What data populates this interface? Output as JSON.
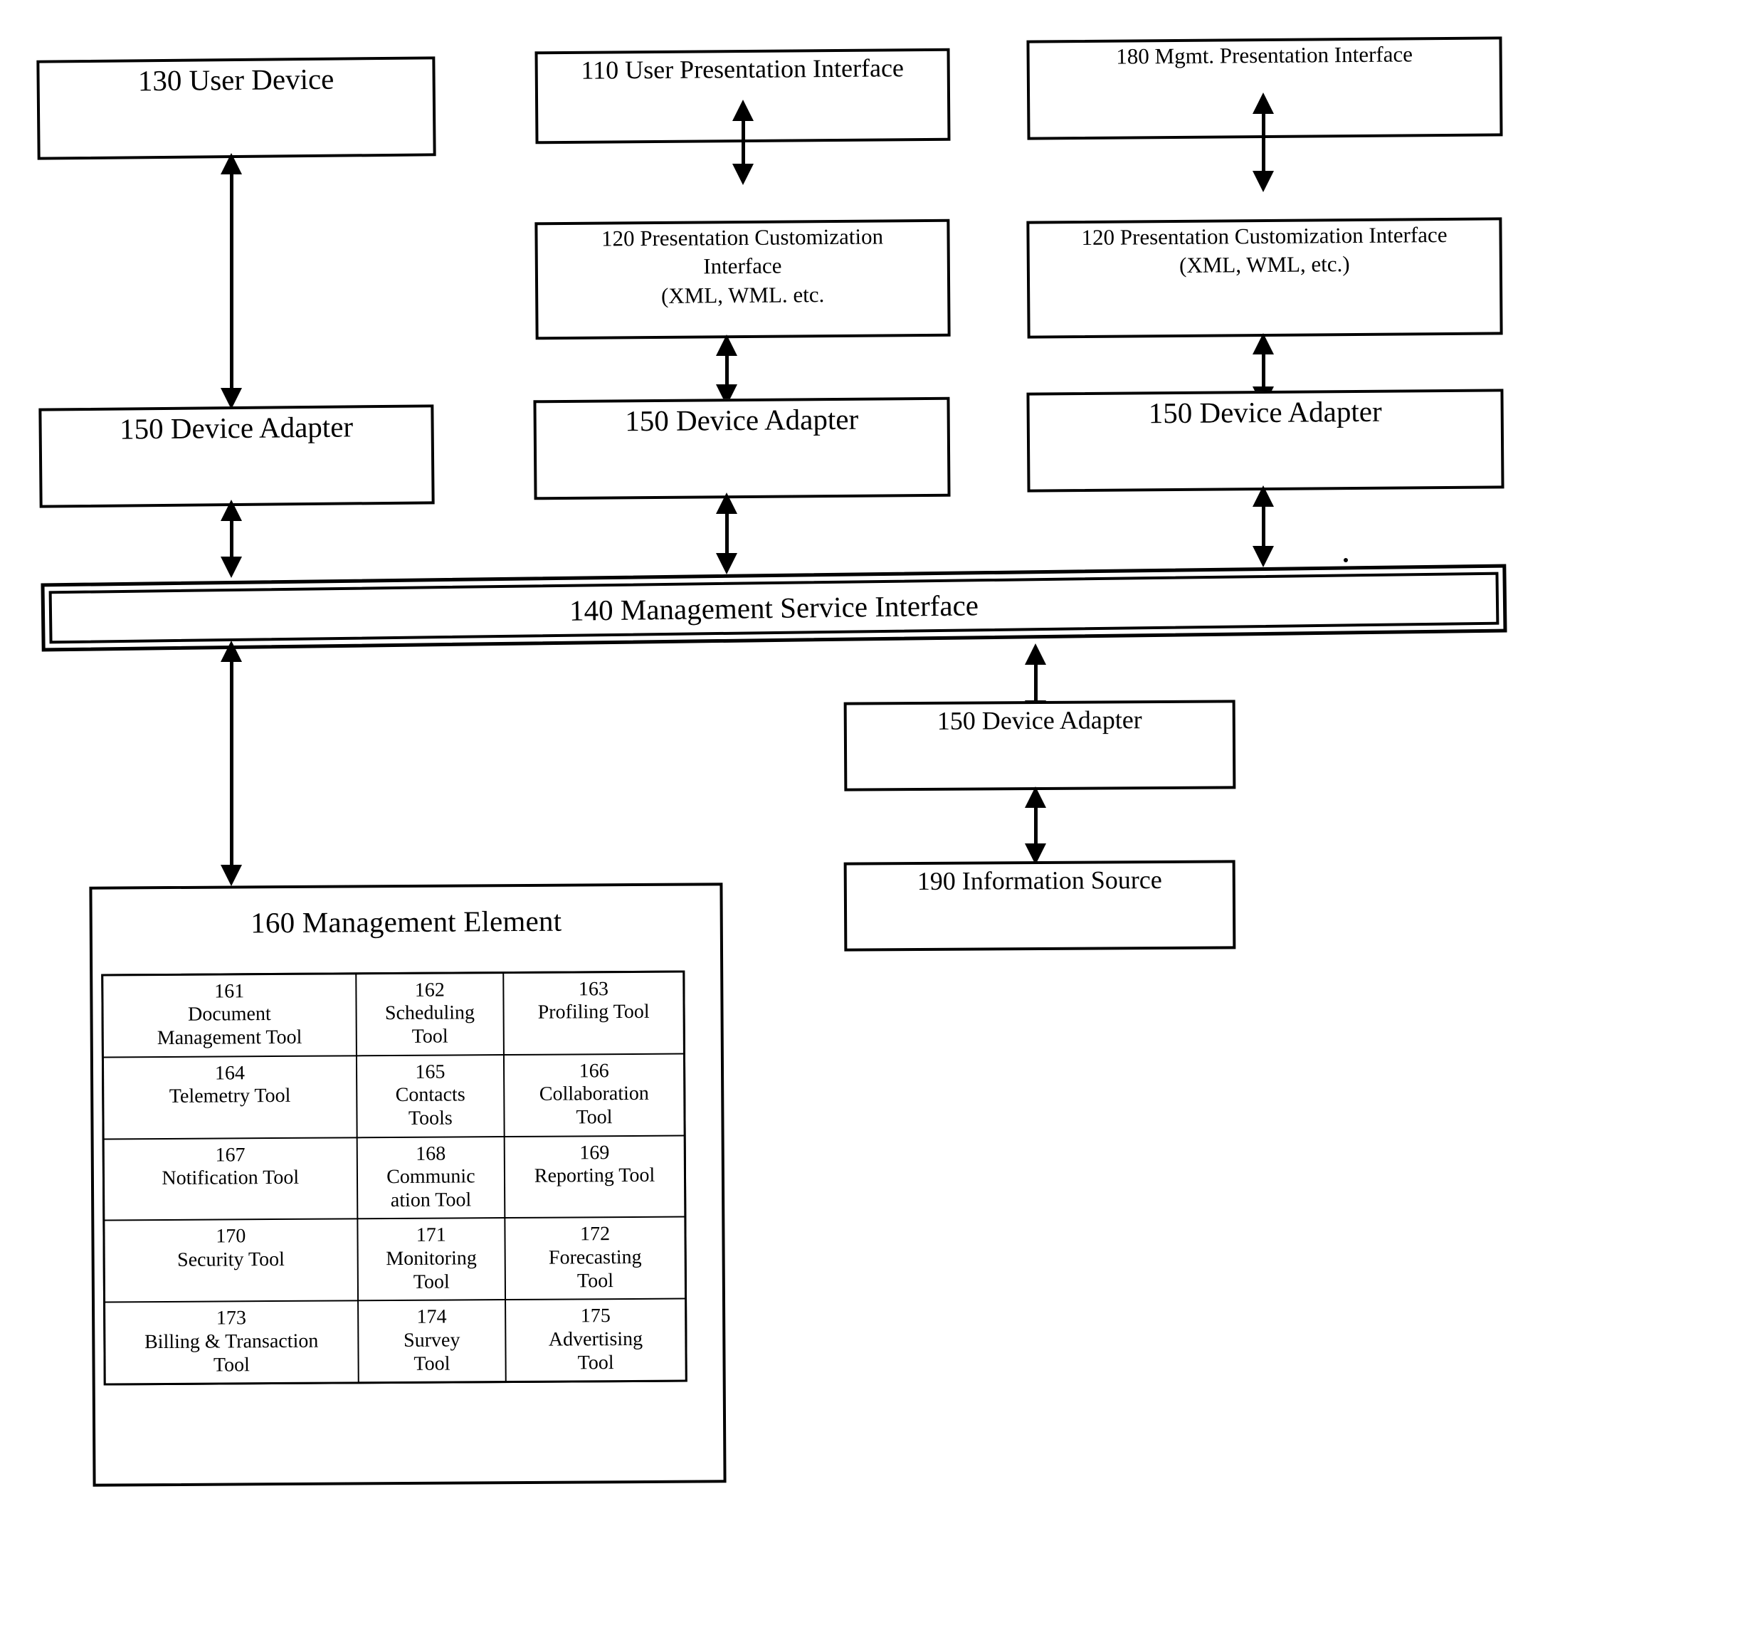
{
  "diagram": {
    "title": "System architecture block diagram",
    "nodes": {
      "user_device": "130 User Device",
      "user_presentation_interface": "110 User Presentation Interface",
      "mgmt_presentation_interface": "180 Mgmt. Presentation Interface",
      "presentation_customization_interface_mid": "120 Presentation Customization\nInterface\n(XML, WML. etc.",
      "presentation_customization_interface_right": "120 Presentation Customization Interface\n(XML, WML, etc.)",
      "device_adapter_left": "150 Device Adapter",
      "device_adapter_mid": "150 Device Adapter",
      "device_adapter_right": "150 Device Adapter",
      "management_service_interface": "140 Management Service Interface",
      "device_adapter_info": "150 Device Adapter",
      "information_source": "190 Information Source",
      "management_element": "160 Management Element"
    },
    "tools": [
      {
        "number": "161",
        "name": "Document\nManagement Tool"
      },
      {
        "number": "162",
        "name": "Scheduling\nTool"
      },
      {
        "number": "163",
        "name": "Profiling Tool"
      },
      {
        "number": "164",
        "name": "Telemetry Tool"
      },
      {
        "number": "165",
        "name": "Contacts\nTools"
      },
      {
        "number": "166",
        "name": "Collaboration\nTool"
      },
      {
        "number": "167",
        "name": "Notification Tool"
      },
      {
        "number": "168",
        "name": "Communic\nation Tool"
      },
      {
        "number": "169",
        "name": "Reporting Tool"
      },
      {
        "number": "170",
        "name": "Security Tool"
      },
      {
        "number": "171",
        "name": "Monitoring\nTool"
      },
      {
        "number": "172",
        "name": "Forecasting\nTool"
      },
      {
        "number": "173",
        "name": "Billing & Transaction\nTool"
      },
      {
        "number": "174",
        "name": "Survey\nTool"
      },
      {
        "number": "175",
        "name": "Advertising\nTool"
      }
    ],
    "connectors": [
      {
        "id": "user-device-to-adapter",
        "type": "double-headed-vertical"
      },
      {
        "id": "user-presentation-to-customization",
        "type": "double-headed-vertical"
      },
      {
        "id": "mgmt-presentation-to-customization",
        "type": "double-headed-vertical"
      },
      {
        "id": "customization-mid-to-adapter",
        "type": "double-headed-vertical"
      },
      {
        "id": "customization-right-to-adapter",
        "type": "double-headed-vertical"
      },
      {
        "id": "adapter-left-to-service",
        "type": "double-headed-vertical"
      },
      {
        "id": "adapter-mid-to-service",
        "type": "double-headed-vertical"
      },
      {
        "id": "adapter-right-to-service",
        "type": "double-headed-vertical"
      },
      {
        "id": "service-to-management-element",
        "type": "double-headed-vertical"
      },
      {
        "id": "service-to-info-adapter",
        "type": "double-headed-vertical"
      },
      {
        "id": "info-adapter-to-information-source",
        "type": "double-headed-vertical"
      }
    ],
    "colors": {
      "stroke": "#000000",
      "background": "#ffffff"
    }
  }
}
